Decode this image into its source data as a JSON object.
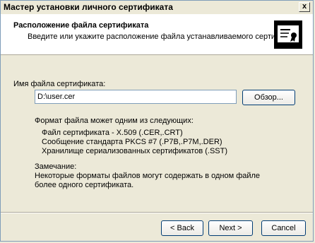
{
  "window": {
    "title": "Мастер установки личного сертификата",
    "close_label": "x"
  },
  "header": {
    "title": "Расположение файла сертификата",
    "subtitle": "Введите или укажите расположение файла устанавливаемого сертификата",
    "icon": "certificate-icon"
  },
  "form": {
    "file_label": "Имя файла сертификата:",
    "file_value": "D:\\user.cer",
    "browse_label": "Обзор..."
  },
  "formats": {
    "heading": "Формат файла может одним из следующих:",
    "items": [
      "Файл сертификата - X.509 (.CER,.CRT)",
      "Сообщение стандарта PKCS #7 (.P7B,.P7M,.DER)",
      "Хранилище сериализованных сертификатов (.SST)"
    ]
  },
  "note": {
    "heading": "Замечание:",
    "body": "Некоторые форматы файлов могут содержать в одном файле более одного сертификата."
  },
  "buttons": {
    "back": "< Back",
    "next": "Next >",
    "cancel": "Cancel"
  }
}
